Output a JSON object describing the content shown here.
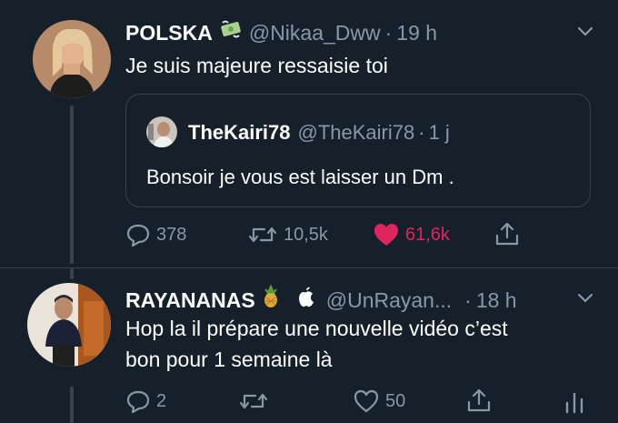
{
  "tweet1": {
    "name": "POLSKA",
    "emoji": "money-with-wings-icon",
    "handle": "@Nikaa_Dww",
    "dot": "·",
    "time": "19 h",
    "text": "Je suis majeure ressaisie toi",
    "quote": {
      "name": "TheKairi78",
      "handle": "@TheKairi78",
      "dot": "·",
      "time": "1 j",
      "text": "Bonsoir je vous est laisser un Dm ."
    },
    "actions": {
      "replies": "378",
      "retweets": "10,5k",
      "likes": "61,6k"
    }
  },
  "tweet2": {
    "name": "RAYANANAS",
    "handle": "@UnRayan...",
    "dot": "·",
    "time": "18 h",
    "text_line1": "Hop la il prépare une nouvelle vidéo c’est",
    "text_line2": "bon pour 1 semaine là",
    "actions": {
      "replies": "2",
      "likes": "50"
    }
  },
  "colors": {
    "background": "#15202b",
    "secondary_text": "#8899a6",
    "like_red": "#e0245e",
    "border": "#38444d"
  }
}
